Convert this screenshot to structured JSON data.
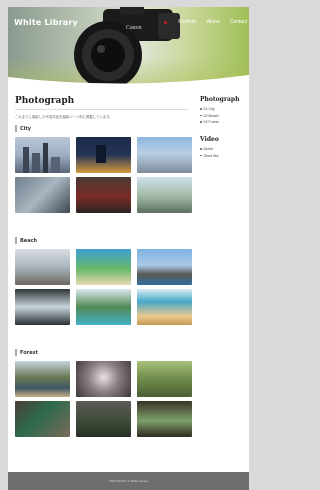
{
  "header": {
    "brand": "White Library",
    "nav": [
      "Portfolio",
      "About",
      "Contact"
    ]
  },
  "main": {
    "title": "Photograph",
    "description": "これまでに撮影した写真作品を撮影シーン別に掲載しています。",
    "sections": [
      {
        "title": "City",
        "photos": [
          "city skyline",
          "night city",
          "city aerial",
          "street",
          "tram",
          "bridge walkway"
        ]
      },
      {
        "title": "Beach",
        "photos": [
          "rocky shore",
          "green coast",
          "rock island",
          "waterfall rocks",
          "palm pool",
          "sand dunes"
        ]
      },
      {
        "title": "Forest",
        "photos": [
          "lake mountains",
          "flower macro",
          "forest path",
          "moss cup",
          "lamp moss",
          "sprouts"
        ]
      }
    ]
  },
  "sidebar": {
    "photograph_title": "Photograph",
    "photograph_links": [
      "01 City",
      "02 Beach",
      "03 Forest"
    ],
    "video_title": "Video",
    "video_links": [
      "Movie",
      "Short film"
    ]
  },
  "footer": {
    "copyright": "COPYRIGHT © White Library"
  },
  "colors": {
    "footer_bg": "#6e6e6e",
    "page_bg": "#ffffff",
    "outer_bg": "#d9d9d9"
  },
  "icons": {
    "header_image": "camera-photo"
  }
}
